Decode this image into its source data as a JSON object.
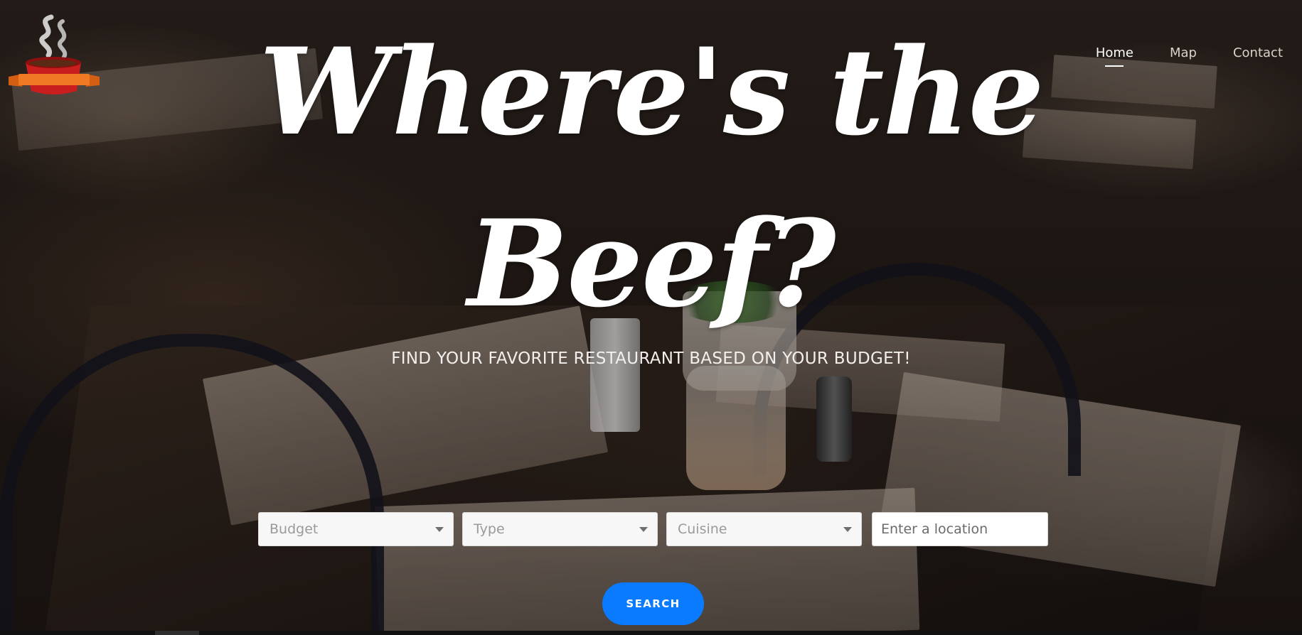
{
  "app": {
    "logo_icon": "coffee-cup-banner-icon"
  },
  "nav": {
    "items": [
      {
        "label": "Home",
        "active": true
      },
      {
        "label": "Map",
        "active": false
      },
      {
        "label": "Contact",
        "active": false
      }
    ]
  },
  "hero": {
    "title_line1": "Where's the",
    "title_line2": "Beef?",
    "tagline": "FIND YOUR FAVORITE RESTAURANT BASED ON YOUR BUDGET!"
  },
  "search": {
    "filters": [
      {
        "label": "Budget",
        "icon": "caret-down-icon"
      },
      {
        "label": "Type",
        "icon": "caret-down-icon"
      },
      {
        "label": "Cuisine",
        "icon": "caret-down-icon"
      }
    ],
    "location_placeholder": "Enter a location",
    "button_label": "SEARCH"
  },
  "colors": {
    "accent": "#0a7bff",
    "logo_cup": "#c81e1e",
    "logo_banner": "#f07a24"
  }
}
